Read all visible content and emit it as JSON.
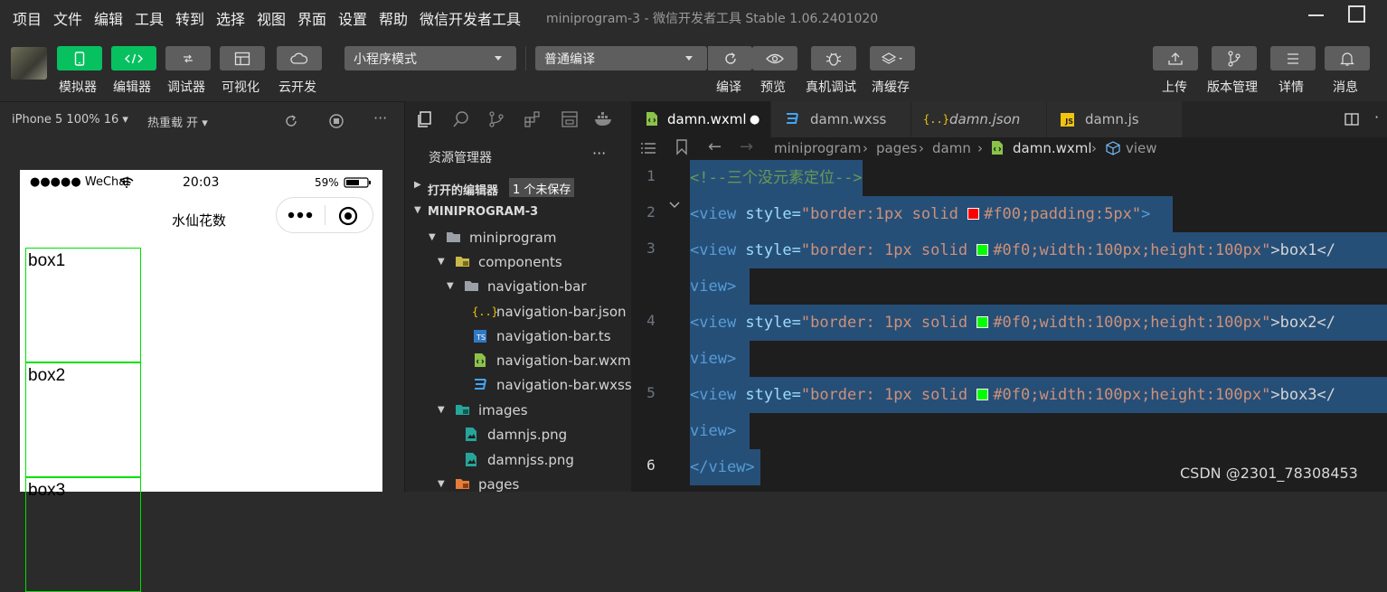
{
  "menu": [
    "项目",
    "文件",
    "编辑",
    "工具",
    "转到",
    "选择",
    "视图",
    "界面",
    "设置",
    "帮助",
    "微信开发者工具"
  ],
  "window_title": "miniprogram-3 - 微信开发者工具 Stable 1.06.2401020",
  "toolbar": {
    "left_labels": [
      "模拟器",
      "编辑器",
      "调试器",
      "可视化",
      "云开发"
    ],
    "mode": "小程序模式",
    "compile_mode": "普通编译",
    "mid_labels": [
      "编译",
      "预览",
      "真机调试",
      "清缓存"
    ],
    "right_labels": [
      "上传",
      "版本管理",
      "详情",
      "消息"
    ]
  },
  "simbar": {
    "device": "iPhone 5 100% 16 ▾",
    "hot_reload": "热重载 开 ▾",
    "more": "···"
  },
  "phone": {
    "carrier": "●●●●● WeChat",
    "time": "20:03",
    "battery": "59%",
    "nav_title": "水仙花数",
    "boxes": [
      "box1",
      "box2",
      "box3"
    ]
  },
  "explorer": {
    "title": "资源管理器",
    "more": "···",
    "open_editors": "打开的编辑器",
    "unsaved_badge": "1 个未保存",
    "project": "MINIPROGRAM-3",
    "tree": [
      {
        "label": "miniprogram",
        "icon": "folder-open-icon"
      },
      {
        "label": "components",
        "icon": "folder-components-icon"
      },
      {
        "label": "navigation-bar",
        "icon": "folder-open-icon"
      },
      {
        "label": "navigation-bar.json",
        "icon": "json-file-icon"
      },
      {
        "label": "navigation-bar.ts",
        "icon": "ts-file-icon"
      },
      {
        "label": "navigation-bar.wxml",
        "icon": "wxml-file-icon"
      },
      {
        "label": "navigation-bar.wxss",
        "icon": "wxss-file-icon"
      },
      {
        "label": "images",
        "icon": "folder-images-icon"
      },
      {
        "label": "damnjs.png",
        "icon": "image-file-icon"
      },
      {
        "label": "damnjss.png",
        "icon": "image-file-icon"
      },
      {
        "label": "pages",
        "icon": "folder-pages-icon"
      }
    ]
  },
  "tabs": [
    {
      "label": "damn.wxml",
      "icon": "wxml-file-icon",
      "active": true,
      "modified": "●"
    },
    {
      "label": "damn.wxss",
      "icon": "wxss-file-icon"
    },
    {
      "label": "damn.json",
      "icon": "json-file-icon"
    },
    {
      "label": "damn.js",
      "icon": "js-file-icon"
    }
  ],
  "breadcrumb": [
    "miniprogram",
    "pages",
    "damn",
    "damn.wxml",
    "view"
  ],
  "code": {
    "line1": "<!--三个没元素定位-->",
    "line2_tag": "<view",
    "line2_attr": " style=",
    "line2_str_a": "\"border:1px solid ",
    "line2_str_b": "#f00;padding:5px\"",
    "line2_end": ">",
    "line_open": "<view",
    "line_attr": " style=",
    "line_str_a": "\"border: 1px solid ",
    "line_str_b": "#0f0;width:100px;height:100px\"",
    "box1_text": ">box1</",
    "box2_text": ">box2</",
    "box3_text": ">box3</",
    "view_close": "view>",
    "line6": "</view>",
    "line_numbers": [
      "1",
      "2",
      "3",
      "4",
      "5",
      "6"
    ]
  },
  "colors": {
    "red_swatch": "#ff0000",
    "green_swatch": "#00ff00",
    "accent": "#07c160"
  },
  "watermark": "CSDN @2301_78308453"
}
